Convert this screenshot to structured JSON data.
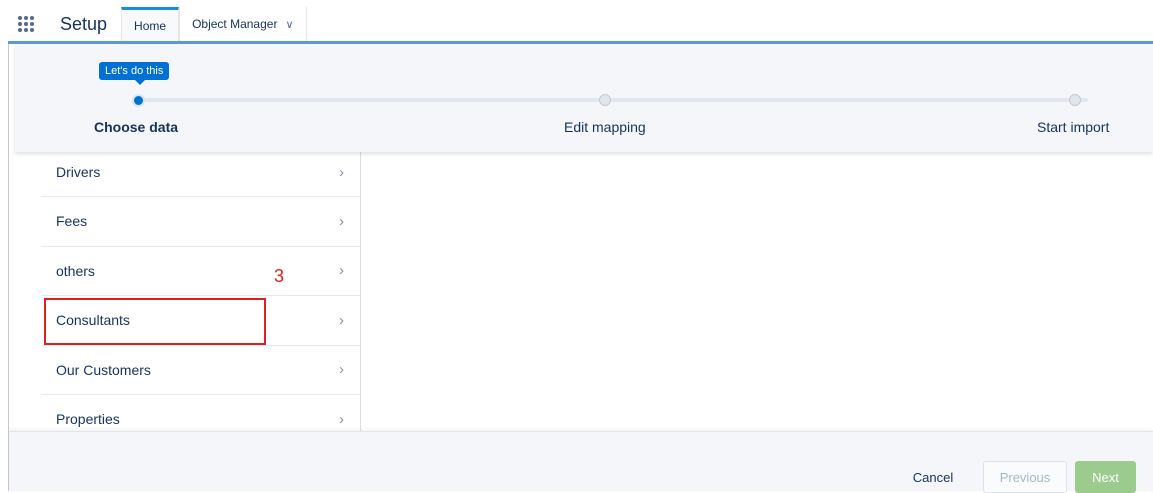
{
  "nav": {
    "app_name": "Setup",
    "tabs": [
      {
        "label": "Home"
      },
      {
        "label": "Object Manager"
      }
    ]
  },
  "progress": {
    "tooltip": "Let's do this",
    "steps": [
      {
        "label": "Choose data",
        "state": "current"
      },
      {
        "label": "Edit mapping",
        "state": "upcoming"
      },
      {
        "label": "Start import",
        "state": "upcoming"
      }
    ]
  },
  "list": {
    "items": [
      {
        "label": "Drivers"
      },
      {
        "label": "Fees"
      },
      {
        "label": "others"
      },
      {
        "label": "Consultants"
      },
      {
        "label": "Our Customers"
      },
      {
        "label": "Properties"
      }
    ]
  },
  "annotation": {
    "number": "3",
    "color": "#e02020"
  },
  "footer": {
    "cancel_label": "Cancel",
    "previous_label": "Previous",
    "next_label": "Next"
  },
  "colors": {
    "accent": "#0070d2",
    "next_button": "#9ccc8d"
  },
  "icons": {
    "launcher": "app-launcher-grid-icon",
    "chevron": "chevron-right-icon",
    "dropdown": "chevron-down-icon"
  }
}
